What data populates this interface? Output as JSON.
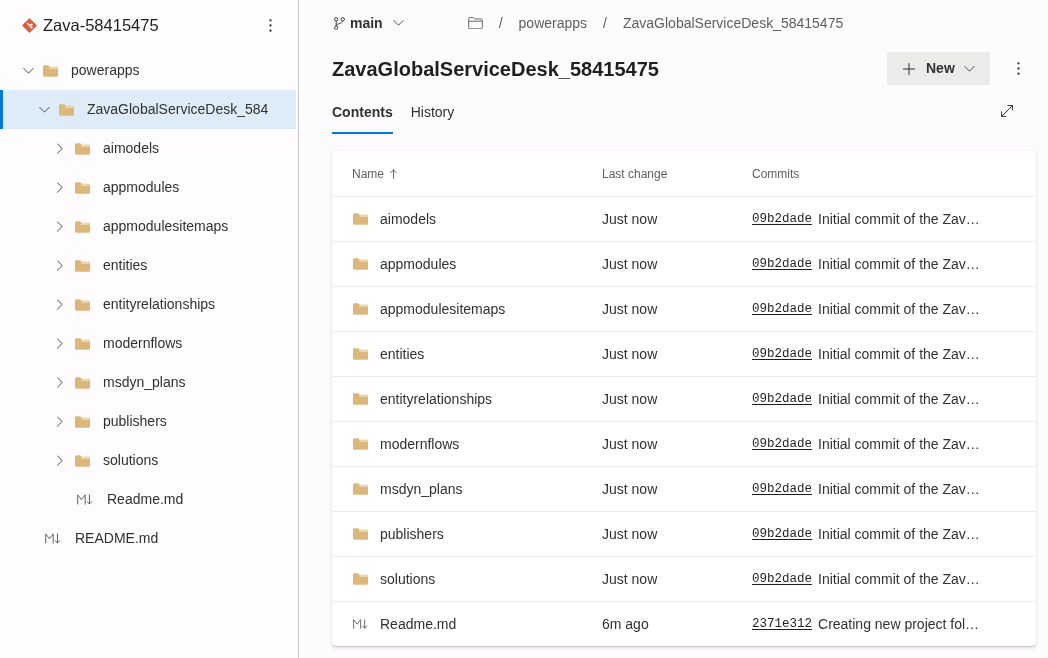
{
  "sidebar": {
    "repo_name": "Zava-58415475",
    "tree": [
      {
        "kind": "folder",
        "name": "powerapps",
        "expanded": true,
        "selected": false,
        "children": [
          {
            "kind": "folder",
            "name": "ZavaGlobalServiceDesk_584",
            "expanded": true,
            "selected": true,
            "children": [
              {
                "kind": "folder",
                "name": "aimodels",
                "expanded": false,
                "selected": false
              },
              {
                "kind": "folder",
                "name": "appmodules",
                "expanded": false,
                "selected": false
              },
              {
                "kind": "folder",
                "name": "appmodulesitemaps",
                "expanded": false,
                "selected": false
              },
              {
                "kind": "folder",
                "name": "entities",
                "expanded": false,
                "selected": false
              },
              {
                "kind": "folder",
                "name": "entityrelationships",
                "expanded": false,
                "selected": false
              },
              {
                "kind": "folder",
                "name": "modernflows",
                "expanded": false,
                "selected": false
              },
              {
                "kind": "folder",
                "name": "msdyn_plans",
                "expanded": false,
                "selected": false
              },
              {
                "kind": "folder",
                "name": "publishers",
                "expanded": false,
                "selected": false
              },
              {
                "kind": "folder",
                "name": "solutions",
                "expanded": false,
                "selected": false
              },
              {
                "kind": "markdown",
                "name": "Readme.md",
                "selected": false
              }
            ]
          }
        ]
      },
      {
        "kind": "markdown",
        "name": "README.md",
        "selected": false
      }
    ]
  },
  "branch": {
    "name": "main"
  },
  "breadcrumb": [
    {
      "separator": "/",
      "label": "powerapps"
    },
    {
      "separator": "/",
      "label": "ZavaGlobalServiceDesk_58415475"
    }
  ],
  "page_title": "ZavaGlobalServiceDesk_58415475",
  "new_button": {
    "label": "New"
  },
  "tabs": [
    {
      "label": "Contents",
      "selected": true
    },
    {
      "label": "History",
      "selected": false
    }
  ],
  "table": {
    "columns": [
      {
        "label": "Name",
        "sorted": true
      },
      {
        "label": "Last change",
        "sorted": false
      },
      {
        "label": "Commits",
        "sorted": false
      }
    ],
    "rows": [
      {
        "kind": "folder",
        "name": "aimodels",
        "last_change": "Just now",
        "commit_id": "09b2dade",
        "commit_message": "Initial commit of the Zav…"
      },
      {
        "kind": "folder",
        "name": "appmodules",
        "last_change": "Just now",
        "commit_id": "09b2dade",
        "commit_message": "Initial commit of the Zav…"
      },
      {
        "kind": "folder",
        "name": "appmodulesitemaps",
        "last_change": "Just now",
        "commit_id": "09b2dade",
        "commit_message": "Initial commit of the Zav…"
      },
      {
        "kind": "folder",
        "name": "entities",
        "last_change": "Just now",
        "commit_id": "09b2dade",
        "commit_message": "Initial commit of the Zav…"
      },
      {
        "kind": "folder",
        "name": "entityrelationships",
        "last_change": "Just now",
        "commit_id": "09b2dade",
        "commit_message": "Initial commit of the Zav…"
      },
      {
        "kind": "folder",
        "name": "modernflows",
        "last_change": "Just now",
        "commit_id": "09b2dade",
        "commit_message": "Initial commit of the Zav…"
      },
      {
        "kind": "folder",
        "name": "msdyn_plans",
        "last_change": "Just now",
        "commit_id": "09b2dade",
        "commit_message": "Initial commit of the Zav…"
      },
      {
        "kind": "folder",
        "name": "publishers",
        "last_change": "Just now",
        "commit_id": "09b2dade",
        "commit_message": "Initial commit of the Zav…"
      },
      {
        "kind": "folder",
        "name": "solutions",
        "last_change": "Just now",
        "commit_id": "09b2dade",
        "commit_message": "Initial commit of the Zav…"
      },
      {
        "kind": "markdown",
        "name": "Readme.md",
        "last_change": "6m ago",
        "commit_id": "2371e312",
        "commit_message": "Creating new project fol…"
      }
    ]
  }
}
